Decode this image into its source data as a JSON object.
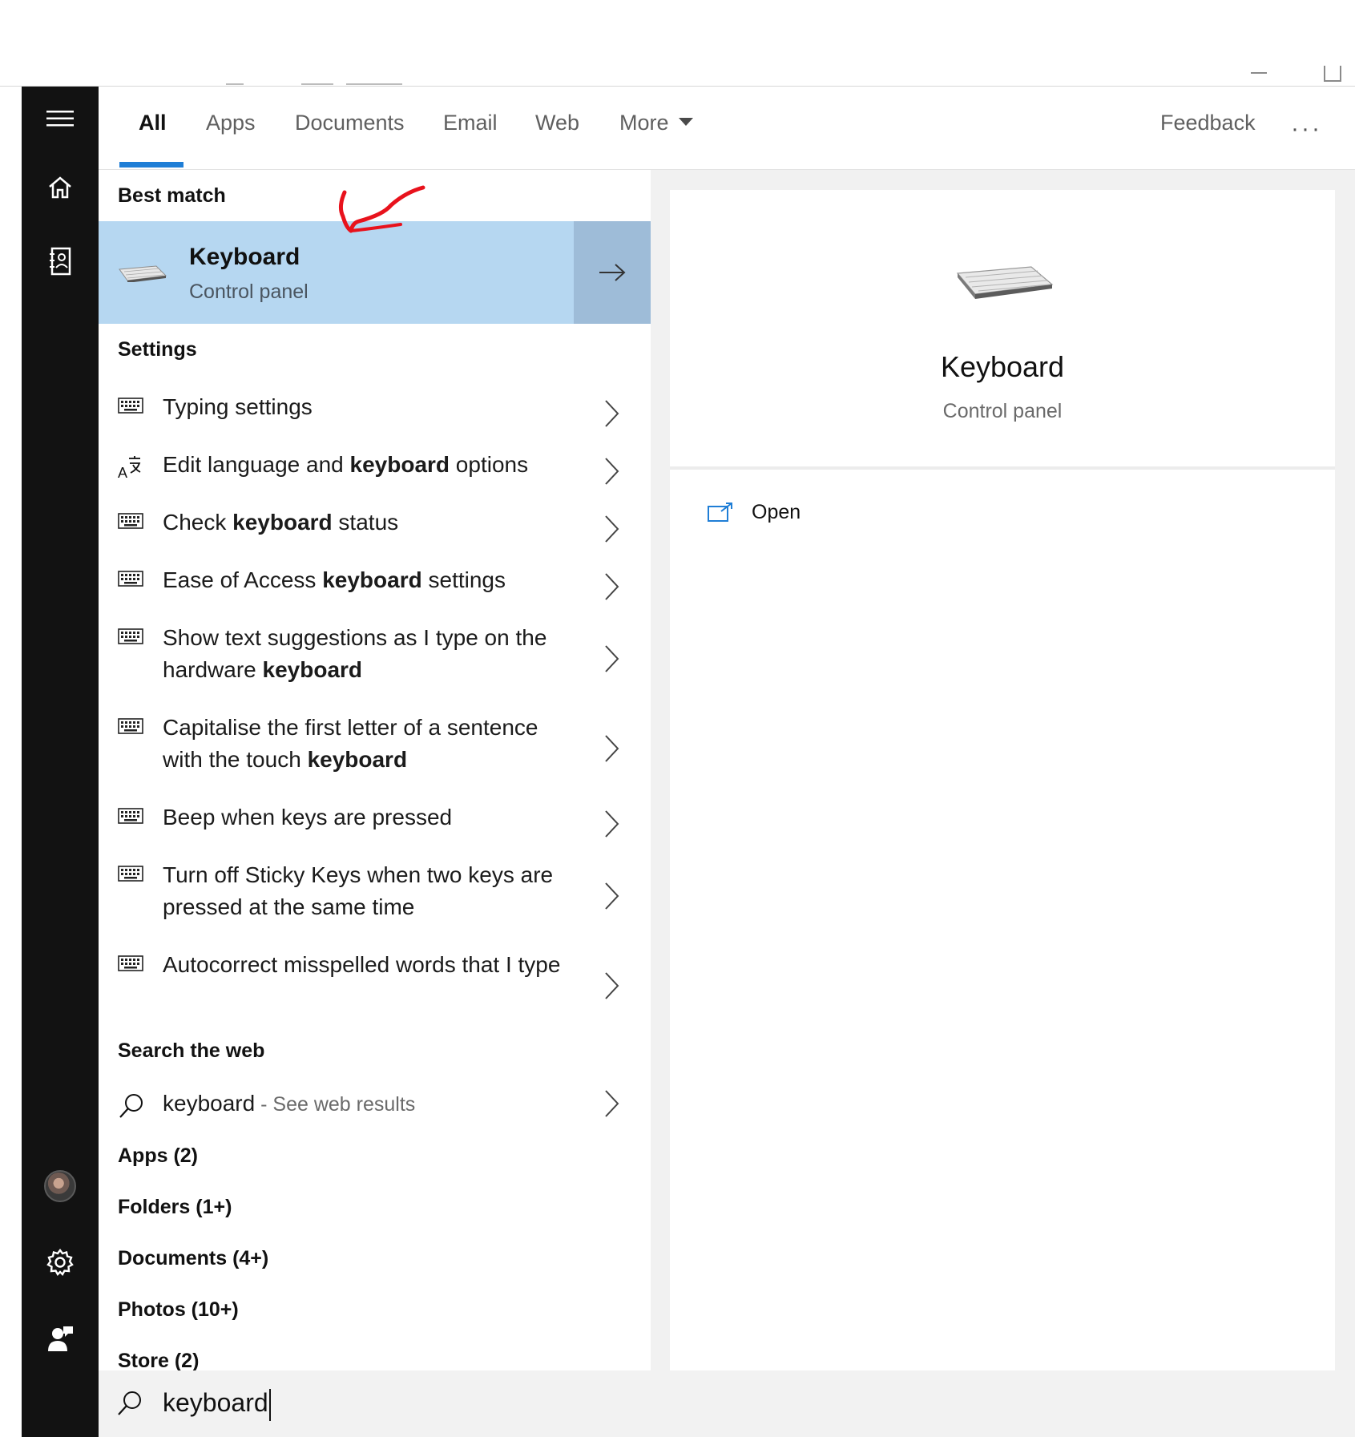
{
  "tabs": {
    "all": "All",
    "apps": "Apps",
    "documents": "Documents",
    "email": "Email",
    "web": "Web",
    "more": "More",
    "feedback": "Feedback",
    "ellipsis": "···"
  },
  "best_match": {
    "heading": "Best match",
    "title": "Keyboard",
    "subtitle": "Control panel"
  },
  "settings": {
    "heading": "Settings",
    "items": [
      {
        "icon": "keyboard-icon",
        "pre": "Typing settings",
        "bold": "",
        "post": ""
      },
      {
        "icon": "language-icon",
        "pre": "Edit language and ",
        "bold": "keyboard",
        "post": " options"
      },
      {
        "icon": "keyboard-icon",
        "pre": "Check ",
        "bold": "keyboard",
        "post": " status"
      },
      {
        "icon": "keyboard-icon",
        "pre": "Ease of Access ",
        "bold": "keyboard",
        "post": " settings"
      },
      {
        "icon": "keyboard-icon",
        "pre": "Show text suggestions as I type on the hardware ",
        "bold": "keyboard",
        "post": ""
      },
      {
        "icon": "keyboard-icon",
        "pre": "Capitalise the first letter of a sentence with the touch ",
        "bold": "keyboard",
        "post": ""
      },
      {
        "icon": "keyboard-icon",
        "pre": "Beep when keys are pressed",
        "bold": "",
        "post": ""
      },
      {
        "icon": "keyboard-icon",
        "pre": "Turn off Sticky Keys when two keys are pressed at the same time",
        "bold": "",
        "post": ""
      },
      {
        "icon": "keyboard-icon",
        "pre": "Autocorrect misspelled words that I type",
        "bold": "",
        "post": ""
      }
    ]
  },
  "web": {
    "heading": "Search the web",
    "query": "keyboard",
    "suffix": " - See web results"
  },
  "categories": [
    "Apps (2)",
    "Folders (1+)",
    "Documents (4+)",
    "Photos (10+)",
    "Store (2)"
  ],
  "preview": {
    "title": "Keyboard",
    "subtitle": "Control panel",
    "open_label": "Open"
  },
  "search": {
    "value": "keyboard"
  },
  "colors": {
    "accent": "#1f7ed6",
    "best_match_bg": "#b6d7f1",
    "annotation": "#e8121c"
  }
}
